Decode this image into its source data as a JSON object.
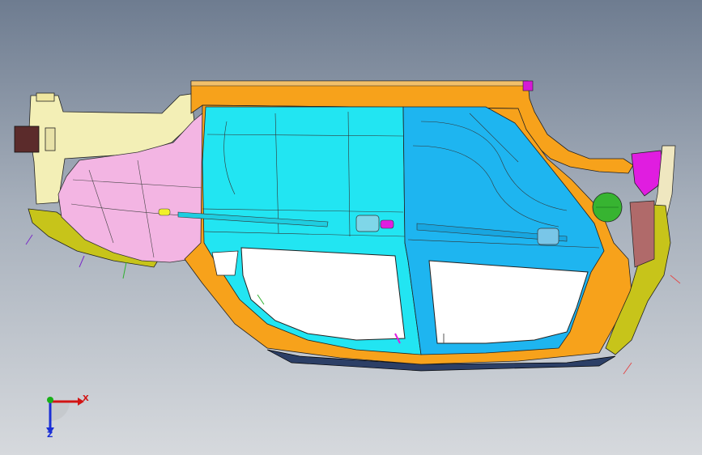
{
  "viewport": {
    "background_top": "#6e7c90",
    "background_bottom": "#d6d9dd"
  },
  "model": {
    "parts": [
      {
        "name": "roof-rail",
        "color": "#f7a21b"
      },
      {
        "name": "front-door-panel",
        "color": "#22e5f2"
      },
      {
        "name": "rear-door-panel",
        "color": "#1eb5f0"
      },
      {
        "name": "front-fender-panel",
        "color": "#f3b5e3"
      },
      {
        "name": "a-pillar-bracket",
        "color": "#f3efb6"
      },
      {
        "name": "bumper-side",
        "color": "#c7c41a"
      },
      {
        "name": "tail-reinforcement",
        "color": "#e01de0"
      },
      {
        "name": "fuel-cap",
        "color": "#37b431"
      }
    ]
  },
  "triad": {
    "x_label": "X",
    "z_label": "Z",
    "x_color": "#d21414",
    "y_color": "#18b018",
    "z_color": "#1a2fd6"
  }
}
